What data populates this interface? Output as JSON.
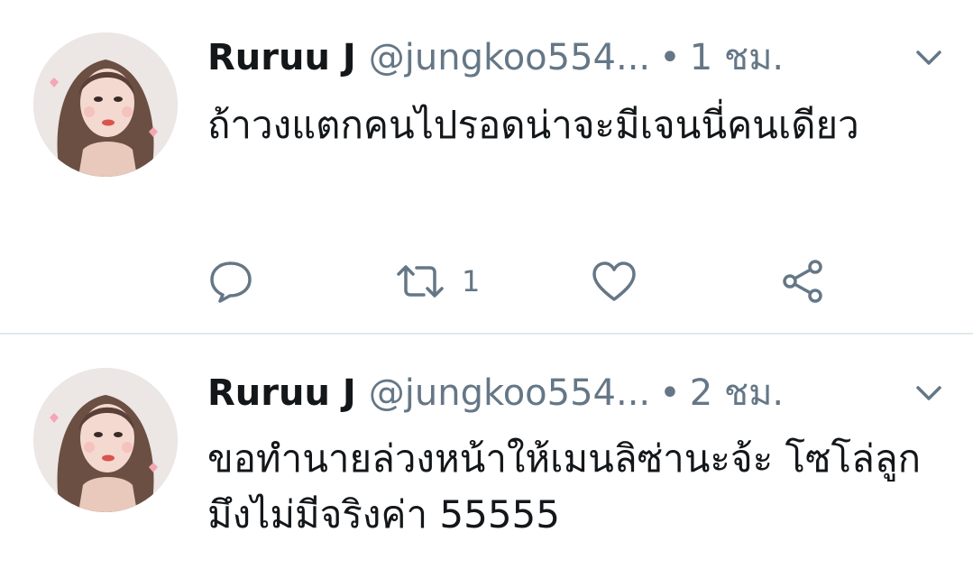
{
  "tweets": [
    {
      "display_name": "Ruruu J",
      "handle": "@jungkoo554...",
      "dot": "•",
      "timestamp": "1 ชม.",
      "text": "ถ้าวงแตกคนไปรอดน่าจะมีเจนนี่คนเดียว",
      "retweet_count": "1",
      "icons": [
        "reply-icon",
        "retweet-icon",
        "like-icon",
        "share-icon"
      ]
    },
    {
      "display_name": "Ruruu J",
      "handle": "@jungkoo554...",
      "dot": "•",
      "timestamp": "2 ชม.",
      "text": "ขอทำนายล่วงหน้าให้เมนลิซ่านะจ้ะ โซโล่ลูกมึงไม่มีจริงค่า 55555"
    }
  ],
  "colors": {
    "primary_text": "#14171a",
    "secondary_text": "#657786",
    "divider": "#e1e8ed",
    "icon": "#657786"
  }
}
